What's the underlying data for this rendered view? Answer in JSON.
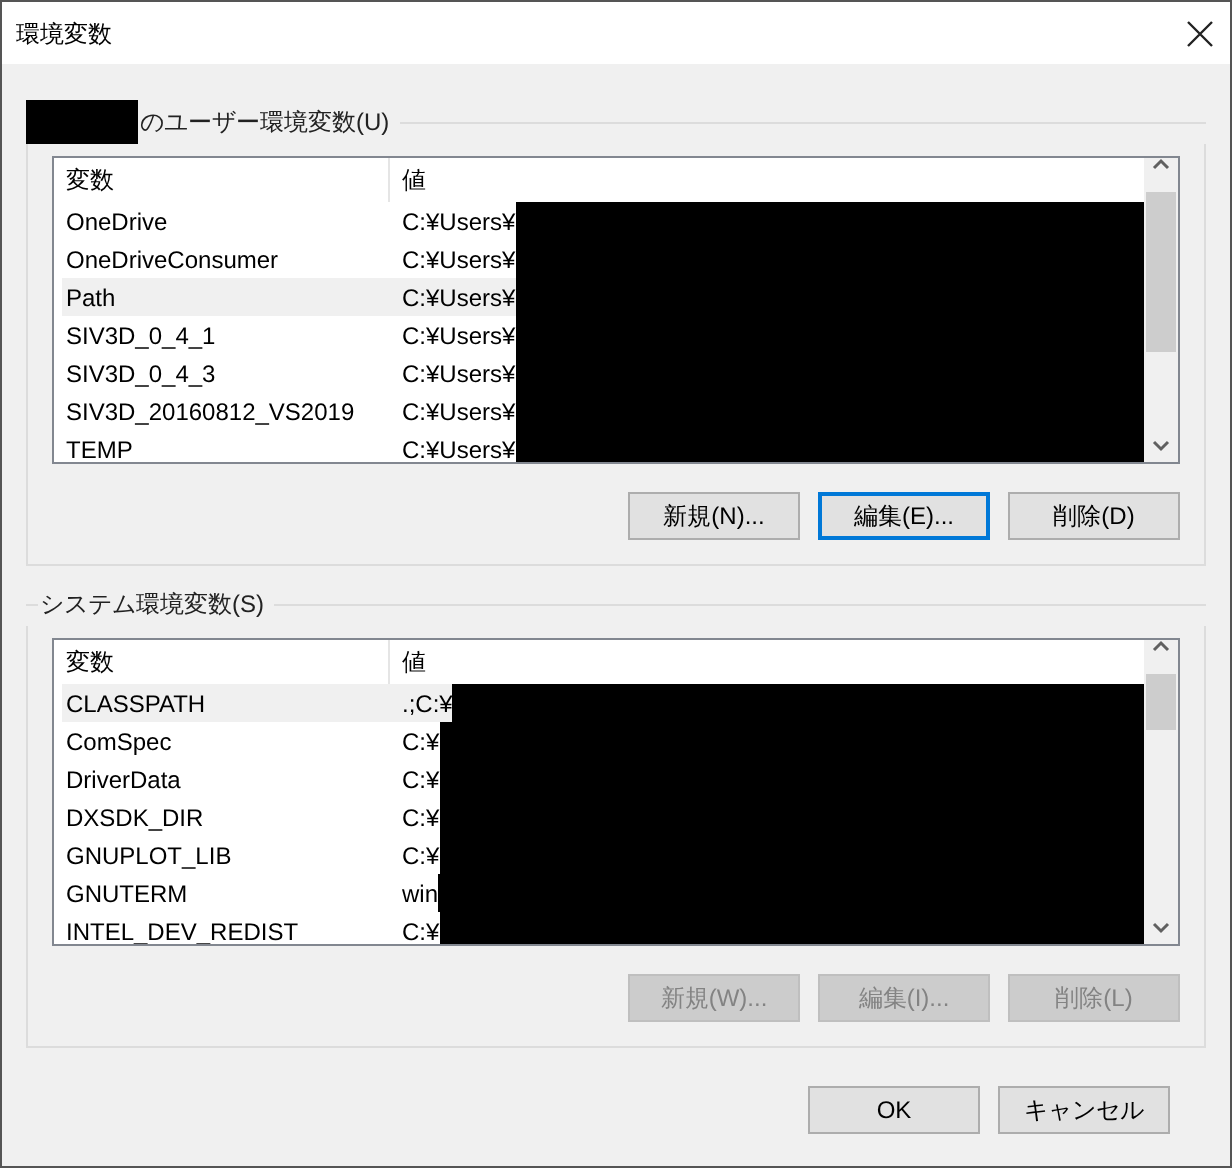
{
  "window": {
    "title": "環境変数"
  },
  "groups": [
    {
      "label": "のユーザー環境変数(U)",
      "owner_redacted": true,
      "columns": [
        "変数",
        "値"
      ],
      "rows": [
        {
          "name": "OneDrive",
          "value": "C:¥Users¥",
          "selected": false
        },
        {
          "name": "OneDriveConsumer",
          "value": "C:¥Users¥",
          "selected": false
        },
        {
          "name": "Path",
          "value": "C:¥Users¥",
          "selected": true
        },
        {
          "name": "SIV3D_0_4_1",
          "value": "C:¥Users¥",
          "selected": false
        },
        {
          "name": "SIV3D_0_4_3",
          "value": "C:¥Users¥",
          "selected": false
        },
        {
          "name": "SIV3D_20160812_VS2019",
          "value": "C:¥Users¥",
          "selected": false
        },
        {
          "name": "TEMP",
          "value": "C:¥Users¥",
          "selected": false
        }
      ],
      "buttons": [
        {
          "label": "新規(N)...",
          "focused": false,
          "disabled": false
        },
        {
          "label": "編集(E)...",
          "focused": true,
          "disabled": false
        },
        {
          "label": "削除(D)",
          "focused": false,
          "disabled": false
        }
      ]
    },
    {
      "label": "システム環境変数(S)",
      "owner_redacted": false,
      "columns": [
        "変数",
        "値"
      ],
      "rows": [
        {
          "name": "CLASSPATH",
          "value": ".;C:¥",
          "selected": true
        },
        {
          "name": "ComSpec",
          "value": "C:¥",
          "selected": false
        },
        {
          "name": "DriverData",
          "value": "C:¥",
          "selected": false
        },
        {
          "name": "DXSDK_DIR",
          "value": "C:¥",
          "selected": false
        },
        {
          "name": "GNUPLOT_LIB",
          "value": "C:¥",
          "selected": false
        },
        {
          "name": "GNUTERM",
          "value": "win",
          "selected": false
        },
        {
          "name": "INTEL_DEV_REDIST",
          "value": "C:¥",
          "selected": false
        }
      ],
      "buttons": [
        {
          "label": "新規(W)...",
          "focused": false,
          "disabled": true
        },
        {
          "label": "編集(I)...",
          "focused": false,
          "disabled": true
        },
        {
          "label": "削除(L)",
          "focused": false,
          "disabled": true
        }
      ]
    }
  ],
  "footer_buttons": [
    {
      "label": "OK"
    },
    {
      "label": "キャンセル"
    }
  ]
}
